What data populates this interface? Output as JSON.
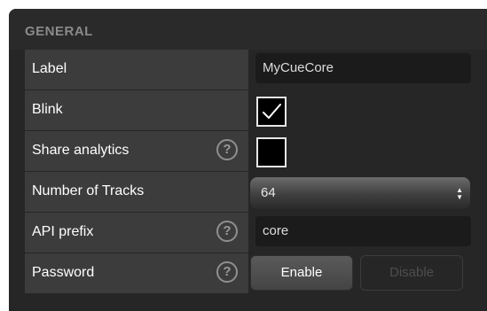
{
  "section": {
    "title": "GENERAL"
  },
  "rows": {
    "label": {
      "label": "Label",
      "value": "MyCueCore"
    },
    "blink": {
      "label": "Blink",
      "checked": true
    },
    "share_analytics": {
      "label": "Share analytics",
      "help": "?",
      "checked": false
    },
    "number_of_tracks": {
      "label": "Number of Tracks",
      "selected": "64",
      "caret": "▲▼"
    },
    "api_prefix": {
      "label": "API prefix",
      "help": "?",
      "value": "core"
    },
    "password": {
      "label": "Password",
      "help": "?",
      "enable_label": "Enable",
      "disable_label": "Disable"
    }
  },
  "colors": {
    "panel_bg": "#262626",
    "label_bg": "#3c3c3c",
    "input_bg": "#1b1b1b",
    "header_text": "#8a8a8a"
  },
  "icons": [
    "help-icon",
    "checkmark-icon",
    "select-caret-icon"
  ]
}
